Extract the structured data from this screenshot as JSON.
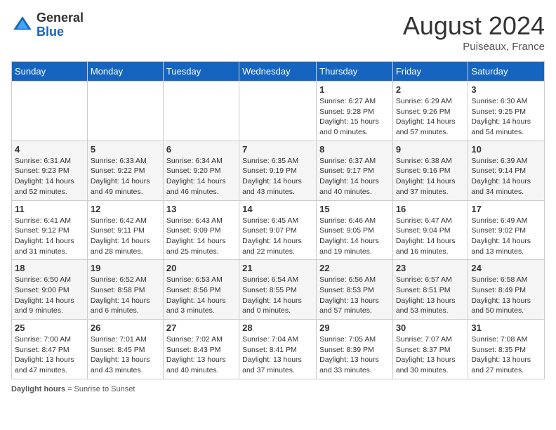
{
  "header": {
    "logo_general": "General",
    "logo_blue": "Blue",
    "month_year": "August 2024",
    "location": "Puiseaux, France"
  },
  "footer": {
    "label": "Daylight hours"
  },
  "days_of_week": [
    "Sunday",
    "Monday",
    "Tuesday",
    "Wednesday",
    "Thursday",
    "Friday",
    "Saturday"
  ],
  "weeks": [
    [
      {
        "day": "",
        "sunrise": "",
        "sunset": "",
        "daylight": ""
      },
      {
        "day": "",
        "sunrise": "",
        "sunset": "",
        "daylight": ""
      },
      {
        "day": "",
        "sunrise": "",
        "sunset": "",
        "daylight": ""
      },
      {
        "day": "",
        "sunrise": "",
        "sunset": "",
        "daylight": ""
      },
      {
        "day": "1",
        "sunrise": "Sunrise: 6:27 AM",
        "sunset": "Sunset: 9:28 PM",
        "daylight": "Daylight: 15 hours and 0 minutes."
      },
      {
        "day": "2",
        "sunrise": "Sunrise: 6:29 AM",
        "sunset": "Sunset: 9:26 PM",
        "daylight": "Daylight: 14 hours and 57 minutes."
      },
      {
        "day": "3",
        "sunrise": "Sunrise: 6:30 AM",
        "sunset": "Sunset: 9:25 PM",
        "daylight": "Daylight: 14 hours and 54 minutes."
      }
    ],
    [
      {
        "day": "4",
        "sunrise": "Sunrise: 6:31 AM",
        "sunset": "Sunset: 9:23 PM",
        "daylight": "Daylight: 14 hours and 52 minutes."
      },
      {
        "day": "5",
        "sunrise": "Sunrise: 6:33 AM",
        "sunset": "Sunset: 9:22 PM",
        "daylight": "Daylight: 14 hours and 49 minutes."
      },
      {
        "day": "6",
        "sunrise": "Sunrise: 6:34 AM",
        "sunset": "Sunset: 9:20 PM",
        "daylight": "Daylight: 14 hours and 46 minutes."
      },
      {
        "day": "7",
        "sunrise": "Sunrise: 6:35 AM",
        "sunset": "Sunset: 9:19 PM",
        "daylight": "Daylight: 14 hours and 43 minutes."
      },
      {
        "day": "8",
        "sunrise": "Sunrise: 6:37 AM",
        "sunset": "Sunset: 9:17 PM",
        "daylight": "Daylight: 14 hours and 40 minutes."
      },
      {
        "day": "9",
        "sunrise": "Sunrise: 6:38 AM",
        "sunset": "Sunset: 9:16 PM",
        "daylight": "Daylight: 14 hours and 37 minutes."
      },
      {
        "day": "10",
        "sunrise": "Sunrise: 6:39 AM",
        "sunset": "Sunset: 9:14 PM",
        "daylight": "Daylight: 14 hours and 34 minutes."
      }
    ],
    [
      {
        "day": "11",
        "sunrise": "Sunrise: 6:41 AM",
        "sunset": "Sunset: 9:12 PM",
        "daylight": "Daylight: 14 hours and 31 minutes."
      },
      {
        "day": "12",
        "sunrise": "Sunrise: 6:42 AM",
        "sunset": "Sunset: 9:11 PM",
        "daylight": "Daylight: 14 hours and 28 minutes."
      },
      {
        "day": "13",
        "sunrise": "Sunrise: 6:43 AM",
        "sunset": "Sunset: 9:09 PM",
        "daylight": "Daylight: 14 hours and 25 minutes."
      },
      {
        "day": "14",
        "sunrise": "Sunrise: 6:45 AM",
        "sunset": "Sunset: 9:07 PM",
        "daylight": "Daylight: 14 hours and 22 minutes."
      },
      {
        "day": "15",
        "sunrise": "Sunrise: 6:46 AM",
        "sunset": "Sunset: 9:05 PM",
        "daylight": "Daylight: 14 hours and 19 minutes."
      },
      {
        "day": "16",
        "sunrise": "Sunrise: 6:47 AM",
        "sunset": "Sunset: 9:04 PM",
        "daylight": "Daylight: 14 hours and 16 minutes."
      },
      {
        "day": "17",
        "sunrise": "Sunrise: 6:49 AM",
        "sunset": "Sunset: 9:02 PM",
        "daylight": "Daylight: 14 hours and 13 minutes."
      }
    ],
    [
      {
        "day": "18",
        "sunrise": "Sunrise: 6:50 AM",
        "sunset": "Sunset: 9:00 PM",
        "daylight": "Daylight: 14 hours and 9 minutes."
      },
      {
        "day": "19",
        "sunrise": "Sunrise: 6:52 AM",
        "sunset": "Sunset: 8:58 PM",
        "daylight": "Daylight: 14 hours and 6 minutes."
      },
      {
        "day": "20",
        "sunrise": "Sunrise: 6:53 AM",
        "sunset": "Sunset: 8:56 PM",
        "daylight": "Daylight: 14 hours and 3 minutes."
      },
      {
        "day": "21",
        "sunrise": "Sunrise: 6:54 AM",
        "sunset": "Sunset: 8:55 PM",
        "daylight": "Daylight: 14 hours and 0 minutes."
      },
      {
        "day": "22",
        "sunrise": "Sunrise: 6:56 AM",
        "sunset": "Sunset: 8:53 PM",
        "daylight": "Daylight: 13 hours and 57 minutes."
      },
      {
        "day": "23",
        "sunrise": "Sunrise: 6:57 AM",
        "sunset": "Sunset: 8:51 PM",
        "daylight": "Daylight: 13 hours and 53 minutes."
      },
      {
        "day": "24",
        "sunrise": "Sunrise: 6:58 AM",
        "sunset": "Sunset: 8:49 PM",
        "daylight": "Daylight: 13 hours and 50 minutes."
      }
    ],
    [
      {
        "day": "25",
        "sunrise": "Sunrise: 7:00 AM",
        "sunset": "Sunset: 8:47 PM",
        "daylight": "Daylight: 13 hours and 47 minutes."
      },
      {
        "day": "26",
        "sunrise": "Sunrise: 7:01 AM",
        "sunset": "Sunset: 8:45 PM",
        "daylight": "Daylight: 13 hours and 43 minutes."
      },
      {
        "day": "27",
        "sunrise": "Sunrise: 7:02 AM",
        "sunset": "Sunset: 8:43 PM",
        "daylight": "Daylight: 13 hours and 40 minutes."
      },
      {
        "day": "28",
        "sunrise": "Sunrise: 7:04 AM",
        "sunset": "Sunset: 8:41 PM",
        "daylight": "Daylight: 13 hours and 37 minutes."
      },
      {
        "day": "29",
        "sunrise": "Sunrise: 7:05 AM",
        "sunset": "Sunset: 8:39 PM",
        "daylight": "Daylight: 13 hours and 33 minutes."
      },
      {
        "day": "30",
        "sunrise": "Sunrise: 7:07 AM",
        "sunset": "Sunset: 8:37 PM",
        "daylight": "Daylight: 13 hours and 30 minutes."
      },
      {
        "day": "31",
        "sunrise": "Sunrise: 7:08 AM",
        "sunset": "Sunset: 8:35 PM",
        "daylight": "Daylight: 13 hours and 27 minutes."
      }
    ]
  ]
}
